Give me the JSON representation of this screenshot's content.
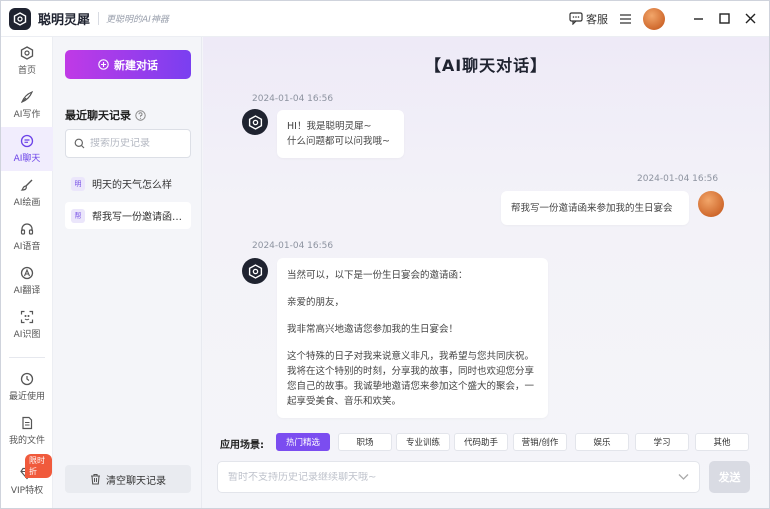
{
  "app": {
    "name": "聪明灵犀",
    "slogan": "更聪明的AI神器",
    "service_label": "客服"
  },
  "nav": {
    "items": [
      {
        "label": "首页",
        "icon": "home-icon"
      },
      {
        "label": "AI写作",
        "icon": "pen-icon"
      },
      {
        "label": "AI聊天",
        "icon": "chat-icon"
      },
      {
        "label": "AI绘画",
        "icon": "brush-icon"
      },
      {
        "label": "AI语音",
        "icon": "headphone-icon"
      },
      {
        "label": "AI翻译",
        "icon": "translate-icon"
      },
      {
        "label": "AI识图",
        "icon": "scan-icon"
      },
      {
        "label": "最近使用",
        "icon": "clock-icon"
      },
      {
        "label": "我的文件",
        "icon": "file-icon"
      },
      {
        "label": "VIP特权",
        "icon": "diamond-icon"
      }
    ],
    "active_index": 2,
    "vip_badge": "限时折"
  },
  "history": {
    "new_chat_label": "新建对话",
    "section_title": "最近聊天记录",
    "search_placeholder": "搜索历史记录",
    "items": [
      {
        "chip": "明",
        "text": "明天的天气怎么样"
      },
      {
        "chip": "帮",
        "text": "帮我写一份邀请函来..."
      }
    ],
    "clear_label": "清空聊天记录"
  },
  "chat": {
    "title": "【AI聊天对话】",
    "messages": [
      {
        "role": "bot",
        "time": "2024-01-04 16:56",
        "lines": [
          "HI！我是聪明灵犀~",
          "什么问题都可以问我哦~"
        ]
      },
      {
        "role": "user",
        "time": "2024-01-04 16:56",
        "lines": [
          "帮我写一份邀请函来参加我的生日宴会"
        ]
      },
      {
        "role": "bot",
        "time": "2024-01-04 16:56",
        "paragraphs": [
          "当然可以，以下是一份生日宴会的邀请函：",
          "亲爱的朋友，",
          "我非常高兴地邀请您参加我的生日宴会！",
          "这个特殊的日子对我来说意义非凡，我希望与您共同庆祝。我将在这个特别的时刻，分享我的故事，同时也欢迎您分享您自己的故事。我诚挚地邀请您来参加这个盛大的聚会，一起享受美食、音乐和欢笑。"
        ]
      }
    ]
  },
  "scenes": {
    "label": "应用场景:",
    "items": [
      "热门精选",
      "职场",
      "专业训练",
      "代码助手",
      "营销/创作",
      "娱乐",
      "学习",
      "其他"
    ],
    "active_index": 0
  },
  "input": {
    "placeholder": "暂时不支持历史记录继续聊天哦~",
    "send_label": "发送"
  }
}
